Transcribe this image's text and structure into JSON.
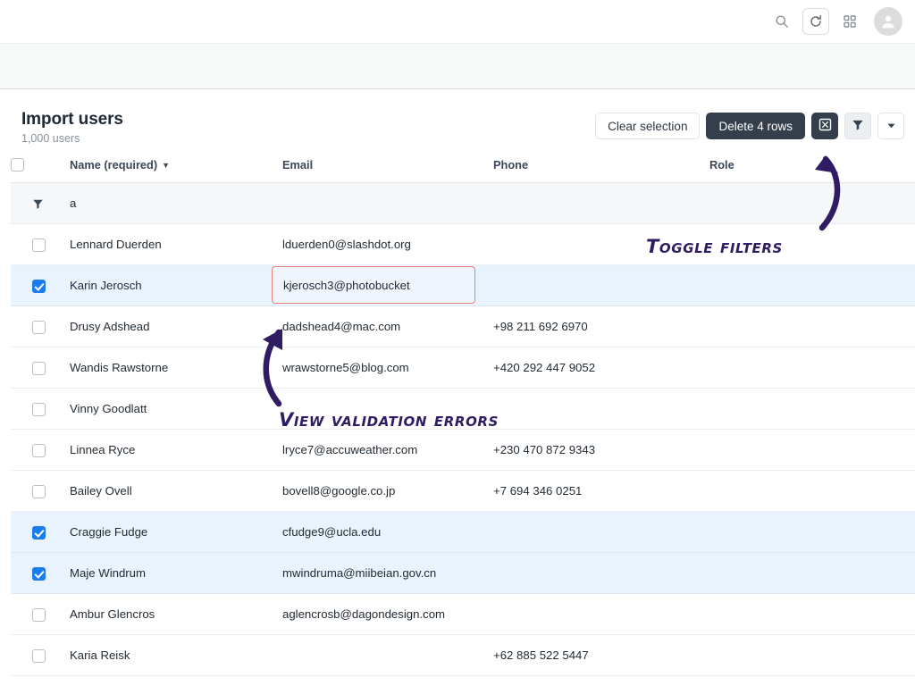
{
  "browser_bar": {
    "icons": [
      {
        "name": "search-icon",
        "label": "Search"
      },
      {
        "name": "reload-icon",
        "label": "Reload"
      },
      {
        "name": "apps-grid-icon",
        "label": "Apps"
      },
      {
        "name": "user-avatar-icon",
        "label": "Account"
      }
    ]
  },
  "header": {
    "title": "Import users",
    "subtitle": "1,000 users",
    "clear_selection_label": "Clear selection",
    "delete_rows_label": "Delete 4 rows",
    "validation_errors_icon": "x-in-box-icon",
    "toggle_filters_icon": "funnel-icon",
    "more_options_icon": "caret-down-icon"
  },
  "table": {
    "columns": [
      {
        "key": "name",
        "label": "Name (required)",
        "sorted": true,
        "sort_caret": "▼"
      },
      {
        "key": "email",
        "label": "Email",
        "sorted": false
      },
      {
        "key": "phone",
        "label": "Phone",
        "sorted": false
      },
      {
        "key": "role",
        "label": "Role",
        "sorted": false
      }
    ],
    "header_select_all_checked": false,
    "filter_row": {
      "icon": "funnel-icon",
      "name_filter_value": "a",
      "email_filter_value": "",
      "phone_filter_value": "",
      "role_filter_value": ""
    },
    "rows": [
      {
        "selected": false,
        "name": "Lennard Duerden",
        "email": "lduerden0@slashdot.org",
        "phone": "",
        "role": "",
        "email_error": false
      },
      {
        "selected": true,
        "name": "Karin Jerosch",
        "email": "kjerosch3@photobucket",
        "phone": "",
        "role": "",
        "email_error": true
      },
      {
        "selected": false,
        "name": "Drusy Adshead",
        "email": "dadshead4@mac.com",
        "phone": "+98 211 692 6970",
        "role": "",
        "email_error": false
      },
      {
        "selected": false,
        "name": "Wandis Rawstorne",
        "email": "wrawstorne5@blog.com",
        "phone": "+420 292 447 9052",
        "role": "",
        "email_error": false
      },
      {
        "selected": false,
        "name": "Vinny Goodlatt",
        "email": "",
        "phone": "",
        "role": "",
        "email_error": false
      },
      {
        "selected": false,
        "name": "Linnea Ryce",
        "email": "lryce7@accuweather.com",
        "phone": "+230 470 872 9343",
        "role": "",
        "email_error": false
      },
      {
        "selected": false,
        "name": "Bailey Ovell",
        "email": "bovell8@google.co.jp",
        "phone": "+7 694 346 0251",
        "role": "",
        "email_error": false
      },
      {
        "selected": true,
        "name": "Craggie Fudge",
        "email": "cfudge9@ucla.edu",
        "phone": "",
        "role": "",
        "email_error": false
      },
      {
        "selected": true,
        "name": "Maje Windrum",
        "email": "mwindruma@miibeian.gov.cn",
        "phone": "",
        "role": "",
        "email_error": false
      },
      {
        "selected": false,
        "name": "Ambur Glencros",
        "email": "aglencrosb@dagondesign.com",
        "phone": "",
        "role": "",
        "email_error": false
      },
      {
        "selected": false,
        "name": "Karia Reisk",
        "email": "",
        "phone": "+62 885 522 5447",
        "role": "",
        "email_error": false
      }
    ]
  },
  "annotations": [
    {
      "text": "Toggle filters",
      "color": "#2f1c63"
    },
    {
      "text": "View validation errors",
      "color": "#2f1c63"
    }
  ],
  "colors": {
    "accent_blue": "#1b7ced",
    "selected_row": "#e9f3fd",
    "dark_button": "#343f4b",
    "error_border": "#e8807c",
    "annotation": "#2f1c63"
  }
}
